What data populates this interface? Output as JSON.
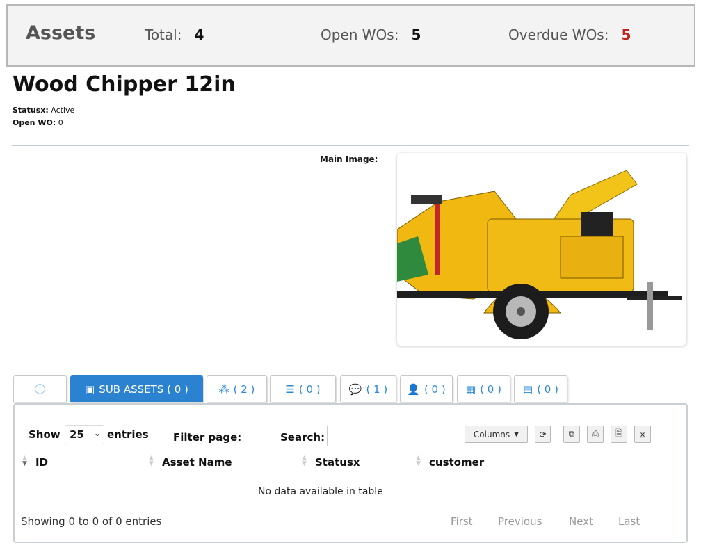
{
  "summary": {
    "title": "Assets",
    "total_label": "Total:",
    "total_value": "4",
    "open_label": "Open WOs:",
    "open_value": "5",
    "overdue_label": "Overdue WOs:",
    "overdue_value": "5"
  },
  "asset": {
    "name": "Wood Chipper 12in",
    "status_label": "Statusx:",
    "status_value": "Active",
    "openwo_label": "Open WO:",
    "openwo_value": "0",
    "main_image_label": "Main Image:"
  },
  "tabs": [
    {
      "icon": "info-icon",
      "label": ""
    },
    {
      "icon": "briefcase-icon",
      "label": "SUB ASSETS ( 0 )"
    },
    {
      "icon": "cubes-icon",
      "label": "( 2 )"
    },
    {
      "icon": "list-icon",
      "label": "( 0 )"
    },
    {
      "icon": "comment-icon",
      "label": "( 1 )"
    },
    {
      "icon": "user-icon",
      "label": "( 0 )"
    },
    {
      "icon": "calendar-icon",
      "label": "( 0 )"
    },
    {
      "icon": "calculator-icon",
      "label": "( 0 )"
    }
  ],
  "table": {
    "show_label": "Show",
    "page_size": "25",
    "entries_label": "entries",
    "filter_label": "Filter page:",
    "search_label": "Search:",
    "columns_button": "Columns",
    "columns": [
      "ID",
      "Asset Name",
      "Statusx",
      "customer"
    ],
    "empty_text": "No data available in table",
    "info_text": "Showing 0 to 0 of 0 entries",
    "pagination": {
      "first": "First",
      "previous": "Previous",
      "next": "Next",
      "last": "Last"
    }
  },
  "colors": {
    "accent": "#2b82d0",
    "overdue": "#c0201a"
  }
}
